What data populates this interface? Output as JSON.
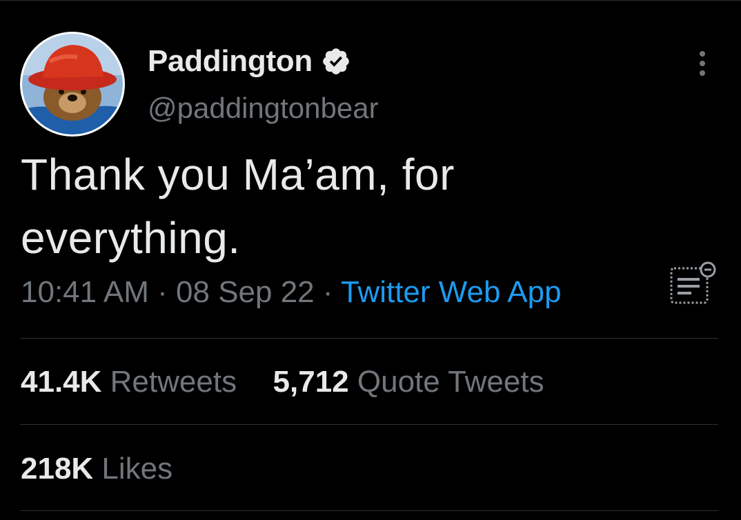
{
  "author": {
    "display_name": "Paddington",
    "handle": "@paddingtonbear",
    "verified": true
  },
  "tweet": {
    "text": "Thank you Ma’am, for everything.",
    "time": "10:41 AM",
    "date": "08 Sep 22",
    "separator": "·",
    "source": "Twitter Web App"
  },
  "stats": {
    "retweets_count": "41.4K",
    "retweets_label": "Retweets",
    "quotes_count": "5,712",
    "quotes_label": "Quote Tweets",
    "likes_count": "218K",
    "likes_label": "Likes"
  },
  "icons": {
    "avatar": "paddington-bear-avatar",
    "verified": "verified-badge-icon",
    "more": "more-options-icon",
    "notes": "notes-icon"
  },
  "colors": {
    "background": "#000000",
    "text_primary": "#e7e9ea",
    "text_secondary": "#71767b",
    "link": "#1d9bf0",
    "divider": "#2f3336"
  }
}
